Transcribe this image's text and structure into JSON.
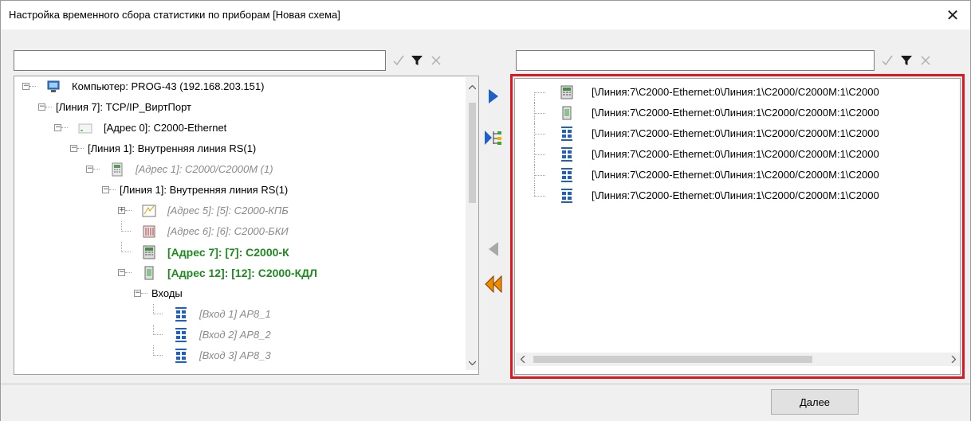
{
  "window": {
    "title": "Настройка временного сбора статистики по приборам [Новая схема]",
    "close_glyph": "✕"
  },
  "left": {
    "filter_value": "",
    "tree": [
      {
        "label": "Компьютер: PROG-43 (192.168.203.151)",
        "icon": "computer-icon",
        "expander": "−",
        "style": "normal"
      },
      {
        "label": "[Линия 7]: TCP/IP_ВиртПорт",
        "icon": null,
        "expander": "−",
        "style": "normal"
      },
      {
        "label": "[Адрес 0]: C2000-Ethernet",
        "icon": "ethernet-device-icon",
        "expander": "−",
        "style": "normal"
      },
      {
        "label": "[Линия 1]: Внутренняя линия RS(1)",
        "icon": null,
        "expander": "−",
        "style": "normal"
      },
      {
        "label": "[Адрес 1]: C2000/C2000M (1)",
        "icon": "controller-device-icon",
        "expander": "−",
        "style": "gray"
      },
      {
        "label": "[Линия 1]: Внутренняя линия RS(1)",
        "icon": null,
        "expander": "−",
        "style": "normal"
      },
      {
        "label": "[Адрес 5]: [5]: C2000-КПБ",
        "icon": "kpb-device-icon",
        "expander": "+",
        "style": "gray"
      },
      {
        "label": "[Адрес 6]: [6]: C2000-БКИ",
        "icon": "bki-device-icon",
        "expander": null,
        "style": "gray"
      },
      {
        "label": "[Адрес 7]: [7]: C2000-К",
        "icon": "keypad-device-icon",
        "expander": null,
        "style": "green"
      },
      {
        "label": "[Адрес 12]: [12]: C2000-КДЛ",
        "icon": "kdl-device-icon",
        "expander": "−",
        "style": "green"
      },
      {
        "label": "Входы",
        "icon": null,
        "expander": "−",
        "style": "normal"
      },
      {
        "label": "[Вход 1] АР8_1",
        "icon": "input-zone-icon",
        "expander": null,
        "style": "gray"
      },
      {
        "label": "[Вход 2] АР8_2",
        "icon": "input-zone-icon",
        "expander": null,
        "style": "gray"
      },
      {
        "label": "[Вход 3] АР8_3",
        "icon": "input-zone-icon",
        "expander": null,
        "style": "gray"
      }
    ]
  },
  "right": {
    "filter_value": "",
    "rows": [
      {
        "label": "[\\Линия:7\\C2000-Ethernet:0\\Линия:1\\C2000/C2000M:1\\C2000",
        "icon": "keypad-device-icon"
      },
      {
        "label": "[\\Линия:7\\C2000-Ethernet:0\\Линия:1\\C2000/C2000M:1\\C2000",
        "icon": "kdl-device-icon"
      },
      {
        "label": "[\\Линия:7\\C2000-Ethernet:0\\Линия:1\\C2000/C2000M:1\\C2000",
        "icon": "input-zone-icon"
      },
      {
        "label": "[\\Линия:7\\C2000-Ethernet:0\\Линия:1\\C2000/C2000M:1\\C2000",
        "icon": "input-zone-icon"
      },
      {
        "label": "[\\Линия:7\\C2000-Ethernet:0\\Линия:1\\C2000/C2000M:1\\C2000",
        "icon": "input-zone-icon"
      },
      {
        "label": "[\\Линия:7\\C2000-Ethernet:0\\Линия:1\\C2000/C2000M:1\\C2000",
        "icon": "input-zone-icon"
      }
    ]
  },
  "footer": {
    "next_label": "Далее"
  },
  "colors": {
    "highlight_border": "#e0161e",
    "green_text": "#1f8a1f",
    "arrow_blue": "#1e5fc8",
    "arrow_orange": "#f08a00"
  }
}
